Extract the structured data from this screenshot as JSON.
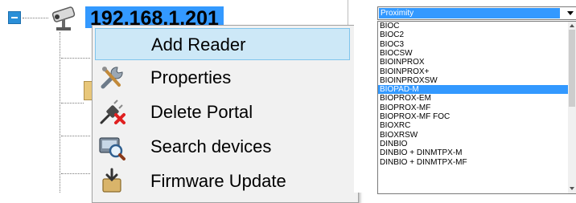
{
  "tree": {
    "node_label": "192.168.1.201"
  },
  "context_menu": {
    "items": [
      {
        "label": "Add Reader",
        "icon": "none"
      },
      {
        "label": "Properties",
        "icon": "tools-icon"
      },
      {
        "label": "Delete Portal",
        "icon": "delete-plug-icon"
      },
      {
        "label": "Search devices",
        "icon": "search-device-icon"
      },
      {
        "label": "Firmware Update",
        "icon": "firmware-update-icon"
      }
    ]
  },
  "reader_type_dropdown": {
    "selected_value": "Proximity",
    "options": [
      "BIOC",
      "BIOC2",
      "BIOC3",
      "BIOCSW",
      "BIOINPROX",
      "BIOINPROX+",
      "BIOINPROXSW",
      "BIOPAD-M",
      "BIOPROX-EM",
      "BIOPROX-MF",
      "BIOPROX-MF FOC",
      "BIOXRC",
      "BIOXRSW",
      "DINBIO",
      "DINBIO + DINMTPX-M",
      "DINBIO + DINMTPX-MF"
    ],
    "highlighted_option": "BIOPAD-M"
  },
  "colors": {
    "selection": "#3399ff",
    "menu_hover": "#cde8f7",
    "menu_bg": "#f1f1f1"
  }
}
